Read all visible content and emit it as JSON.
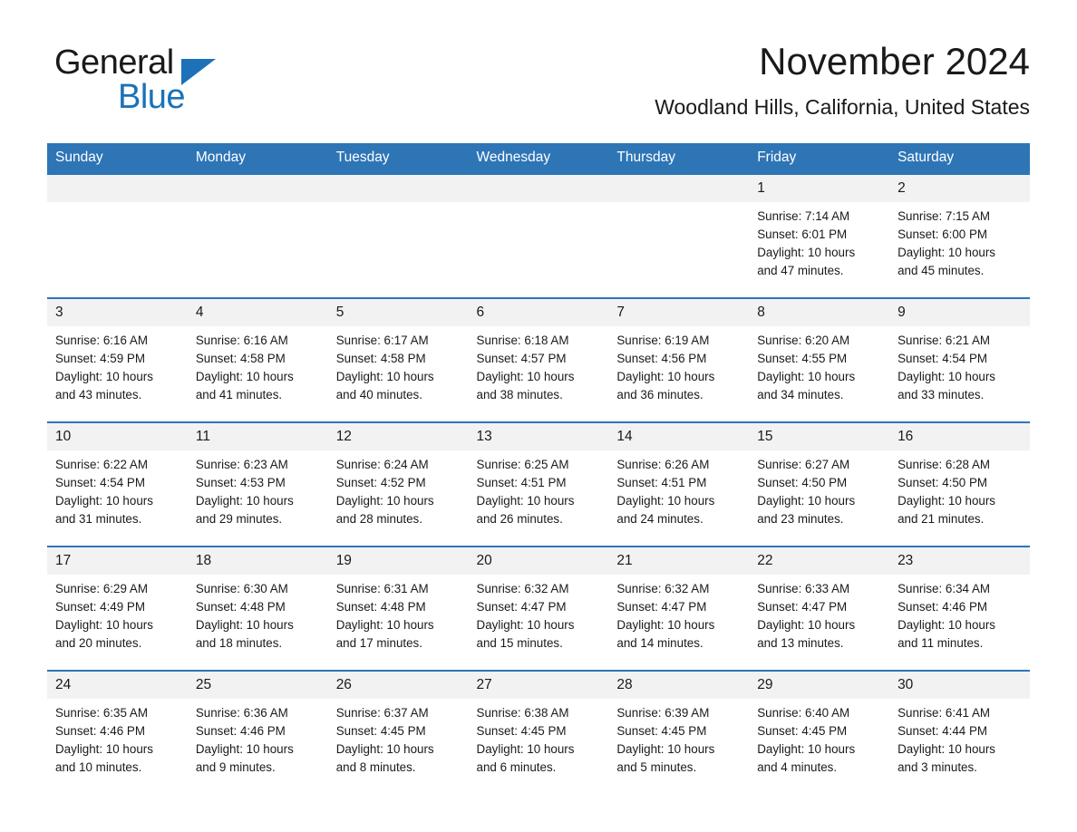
{
  "brand": {
    "name_part1": "General",
    "name_part2": "Blue",
    "accent_color": "#1a72b8",
    "logo_icon": "triangle-flag-icon"
  },
  "header": {
    "title": "November 2024",
    "subtitle": "Woodland Hills, California, United States"
  },
  "theme": {
    "header_bg": "#2e75b6",
    "header_text": "#ffffff",
    "row_border": "#2e75b6",
    "daynum_bg": "#f2f2f2",
    "page_bg": "#ffffff",
    "text": "#1a1a1a"
  },
  "weekday_headers": [
    "Sunday",
    "Monday",
    "Tuesday",
    "Wednesday",
    "Thursday",
    "Friday",
    "Saturday"
  ],
  "weeks": [
    [
      {
        "day": "",
        "blank": true
      },
      {
        "day": "",
        "blank": true
      },
      {
        "day": "",
        "blank": true
      },
      {
        "day": "",
        "blank": true
      },
      {
        "day": "",
        "blank": true
      },
      {
        "day": "1",
        "sunrise": "Sunrise: 7:14 AM",
        "sunset": "Sunset: 6:01 PM",
        "daylight_line1": "Daylight: 10 hours",
        "daylight_line2": "and 47 minutes."
      },
      {
        "day": "2",
        "sunrise": "Sunrise: 7:15 AM",
        "sunset": "Sunset: 6:00 PM",
        "daylight_line1": "Daylight: 10 hours",
        "daylight_line2": "and 45 minutes."
      }
    ],
    [
      {
        "day": "3",
        "sunrise": "Sunrise: 6:16 AM",
        "sunset": "Sunset: 4:59 PM",
        "daylight_line1": "Daylight: 10 hours",
        "daylight_line2": "and 43 minutes."
      },
      {
        "day": "4",
        "sunrise": "Sunrise: 6:16 AM",
        "sunset": "Sunset: 4:58 PM",
        "daylight_line1": "Daylight: 10 hours",
        "daylight_line2": "and 41 minutes."
      },
      {
        "day": "5",
        "sunrise": "Sunrise: 6:17 AM",
        "sunset": "Sunset: 4:58 PM",
        "daylight_line1": "Daylight: 10 hours",
        "daylight_line2": "and 40 minutes."
      },
      {
        "day": "6",
        "sunrise": "Sunrise: 6:18 AM",
        "sunset": "Sunset: 4:57 PM",
        "daylight_line1": "Daylight: 10 hours",
        "daylight_line2": "and 38 minutes."
      },
      {
        "day": "7",
        "sunrise": "Sunrise: 6:19 AM",
        "sunset": "Sunset: 4:56 PM",
        "daylight_line1": "Daylight: 10 hours",
        "daylight_line2": "and 36 minutes."
      },
      {
        "day": "8",
        "sunrise": "Sunrise: 6:20 AM",
        "sunset": "Sunset: 4:55 PM",
        "daylight_line1": "Daylight: 10 hours",
        "daylight_line2": "and 34 minutes."
      },
      {
        "day": "9",
        "sunrise": "Sunrise: 6:21 AM",
        "sunset": "Sunset: 4:54 PM",
        "daylight_line1": "Daylight: 10 hours",
        "daylight_line2": "and 33 minutes."
      }
    ],
    [
      {
        "day": "10",
        "sunrise": "Sunrise: 6:22 AM",
        "sunset": "Sunset: 4:54 PM",
        "daylight_line1": "Daylight: 10 hours",
        "daylight_line2": "and 31 minutes."
      },
      {
        "day": "11",
        "sunrise": "Sunrise: 6:23 AM",
        "sunset": "Sunset: 4:53 PM",
        "daylight_line1": "Daylight: 10 hours",
        "daylight_line2": "and 29 minutes."
      },
      {
        "day": "12",
        "sunrise": "Sunrise: 6:24 AM",
        "sunset": "Sunset: 4:52 PM",
        "daylight_line1": "Daylight: 10 hours",
        "daylight_line2": "and 28 minutes."
      },
      {
        "day": "13",
        "sunrise": "Sunrise: 6:25 AM",
        "sunset": "Sunset: 4:51 PM",
        "daylight_line1": "Daylight: 10 hours",
        "daylight_line2": "and 26 minutes."
      },
      {
        "day": "14",
        "sunrise": "Sunrise: 6:26 AM",
        "sunset": "Sunset: 4:51 PM",
        "daylight_line1": "Daylight: 10 hours",
        "daylight_line2": "and 24 minutes."
      },
      {
        "day": "15",
        "sunrise": "Sunrise: 6:27 AM",
        "sunset": "Sunset: 4:50 PM",
        "daylight_line1": "Daylight: 10 hours",
        "daylight_line2": "and 23 minutes."
      },
      {
        "day": "16",
        "sunrise": "Sunrise: 6:28 AM",
        "sunset": "Sunset: 4:50 PM",
        "daylight_line1": "Daylight: 10 hours",
        "daylight_line2": "and 21 minutes."
      }
    ],
    [
      {
        "day": "17",
        "sunrise": "Sunrise: 6:29 AM",
        "sunset": "Sunset: 4:49 PM",
        "daylight_line1": "Daylight: 10 hours",
        "daylight_line2": "and 20 minutes."
      },
      {
        "day": "18",
        "sunrise": "Sunrise: 6:30 AM",
        "sunset": "Sunset: 4:48 PM",
        "daylight_line1": "Daylight: 10 hours",
        "daylight_line2": "and 18 minutes."
      },
      {
        "day": "19",
        "sunrise": "Sunrise: 6:31 AM",
        "sunset": "Sunset: 4:48 PM",
        "daylight_line1": "Daylight: 10 hours",
        "daylight_line2": "and 17 minutes."
      },
      {
        "day": "20",
        "sunrise": "Sunrise: 6:32 AM",
        "sunset": "Sunset: 4:47 PM",
        "daylight_line1": "Daylight: 10 hours",
        "daylight_line2": "and 15 minutes."
      },
      {
        "day": "21",
        "sunrise": "Sunrise: 6:32 AM",
        "sunset": "Sunset: 4:47 PM",
        "daylight_line1": "Daylight: 10 hours",
        "daylight_line2": "and 14 minutes."
      },
      {
        "day": "22",
        "sunrise": "Sunrise: 6:33 AM",
        "sunset": "Sunset: 4:47 PM",
        "daylight_line1": "Daylight: 10 hours",
        "daylight_line2": "and 13 minutes."
      },
      {
        "day": "23",
        "sunrise": "Sunrise: 6:34 AM",
        "sunset": "Sunset: 4:46 PM",
        "daylight_line1": "Daylight: 10 hours",
        "daylight_line2": "and 11 minutes."
      }
    ],
    [
      {
        "day": "24",
        "sunrise": "Sunrise: 6:35 AM",
        "sunset": "Sunset: 4:46 PM",
        "daylight_line1": "Daylight: 10 hours",
        "daylight_line2": "and 10 minutes."
      },
      {
        "day": "25",
        "sunrise": "Sunrise: 6:36 AM",
        "sunset": "Sunset: 4:46 PM",
        "daylight_line1": "Daylight: 10 hours",
        "daylight_line2": "and 9 minutes."
      },
      {
        "day": "26",
        "sunrise": "Sunrise: 6:37 AM",
        "sunset": "Sunset: 4:45 PM",
        "daylight_line1": "Daylight: 10 hours",
        "daylight_line2": "and 8 minutes."
      },
      {
        "day": "27",
        "sunrise": "Sunrise: 6:38 AM",
        "sunset": "Sunset: 4:45 PM",
        "daylight_line1": "Daylight: 10 hours",
        "daylight_line2": "and 6 minutes."
      },
      {
        "day": "28",
        "sunrise": "Sunrise: 6:39 AM",
        "sunset": "Sunset: 4:45 PM",
        "daylight_line1": "Daylight: 10 hours",
        "daylight_line2": "and 5 minutes."
      },
      {
        "day": "29",
        "sunrise": "Sunrise: 6:40 AM",
        "sunset": "Sunset: 4:45 PM",
        "daylight_line1": "Daylight: 10 hours",
        "daylight_line2": "and 4 minutes."
      },
      {
        "day": "30",
        "sunrise": "Sunrise: 6:41 AM",
        "sunset": "Sunset: 4:44 PM",
        "daylight_line1": "Daylight: 10 hours",
        "daylight_line2": "and 3 minutes."
      }
    ]
  ]
}
